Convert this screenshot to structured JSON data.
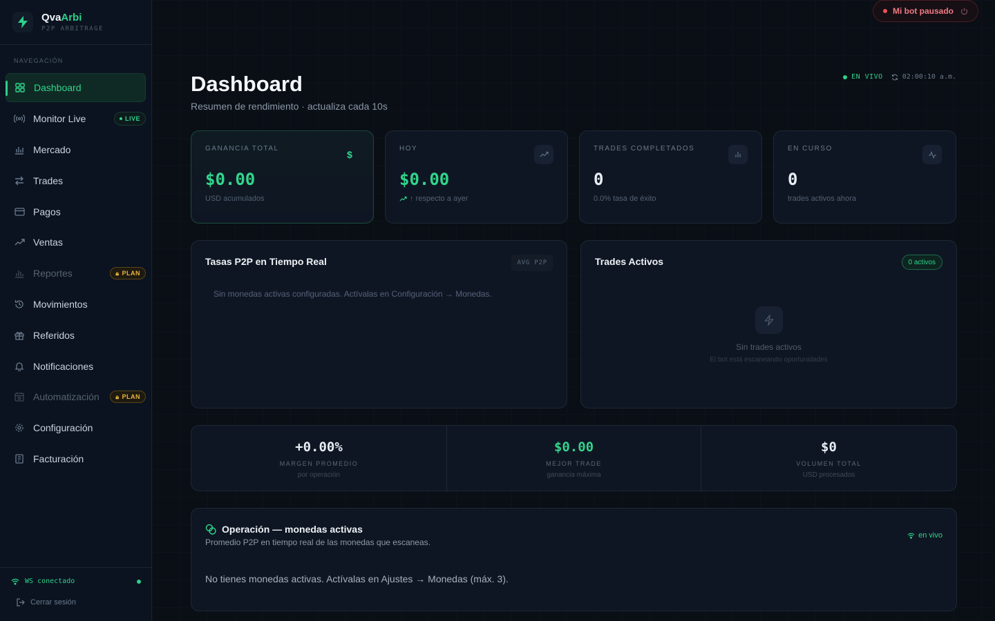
{
  "brand": {
    "name_a": "Qva",
    "name_b": "Arbi",
    "subtitle": "P2P ARBITRAGE"
  },
  "nav": {
    "heading": "NAVEGACIÓN",
    "items": [
      {
        "label": "Dashboard",
        "icon": "grid-icon",
        "active": true
      },
      {
        "label": "Monitor Live",
        "icon": "broadcast-icon",
        "badge": "LIVE"
      },
      {
        "label": "Mercado",
        "icon": "bar-chart-icon"
      },
      {
        "label": "Trades",
        "icon": "swap-arrows-icon"
      },
      {
        "label": "Pagos",
        "icon": "credit-card-icon"
      },
      {
        "label": "Ventas",
        "icon": "trending-up-icon"
      },
      {
        "label": "Reportes",
        "icon": "report-bars-icon",
        "badge": "PLAN",
        "disabled": true
      },
      {
        "label": "Movimientos",
        "icon": "history-icon"
      },
      {
        "label": "Referidos",
        "icon": "gift-icon"
      },
      {
        "label": "Notificaciones",
        "icon": "bell-icon"
      },
      {
        "label": "Automatización",
        "icon": "calendar-automation-icon",
        "badge": "PLAN",
        "disabled": true
      },
      {
        "label": "Configuración",
        "icon": "gear-icon"
      },
      {
        "label": "Facturación",
        "icon": "invoice-icon"
      }
    ]
  },
  "footer": {
    "ws_status": "WS conectado",
    "logout": "Cerrar sesión"
  },
  "topbar": {
    "bot_status": "Mi bot pausado"
  },
  "header": {
    "title": "Dashboard",
    "subtitle": "Resumen de rendimiento · actualiza cada 10s",
    "live_label": "EN VIVO",
    "time": "02:00:10 a.m."
  },
  "stats": [
    {
      "label": "GANANCIA TOTAL",
      "value": "$0.00",
      "foot": "USD acumulados",
      "icon": "dollar-icon"
    },
    {
      "label": "HOY",
      "value": "$0.00",
      "foot": "↑ respecto a ayer",
      "icon": "trending-up-icon"
    },
    {
      "label": "TRADES COMPLETADOS",
      "value": "0",
      "foot": "0.0% tasa de éxito",
      "icon": "bar-chart-icon"
    },
    {
      "label": "EN CURSO",
      "value": "0",
      "foot": "trades activos ahora",
      "icon": "activity-icon"
    }
  ],
  "rates_panel": {
    "title": "Tasas P2P en Tiempo Real",
    "chip": "AVG P2P",
    "empty": "Sin monedas activas configuradas. Actívalas en Configuración → Monedas."
  },
  "trades_panel": {
    "title": "Trades Activos",
    "chip": "0 activos",
    "empty_title": "Sin trades activos",
    "empty_sub": "El bot está escaneando oportunidades"
  },
  "metrics": [
    {
      "value": "+0.00%",
      "label": "MARGEN PROMEDIO",
      "sub": "por operación"
    },
    {
      "value": "$0.00",
      "label": "MEJOR TRADE",
      "sub": "ganancia máxima"
    },
    {
      "value": "$0",
      "label": "VOLUMEN TOTAL",
      "sub": "USD procesados"
    }
  ],
  "operation": {
    "title": "Operación — monedas activas",
    "subtitle": "Promedio P2P en tiempo real de las monedas que escaneas.",
    "live": "en vivo",
    "empty": "No tienes monedas activas. Actívalas en Ajustes → Monedas (máx. 3)."
  },
  "colors": {
    "accent": "#2fd08a",
    "warning": "#e8b441",
    "danger": "#f04f5c"
  }
}
